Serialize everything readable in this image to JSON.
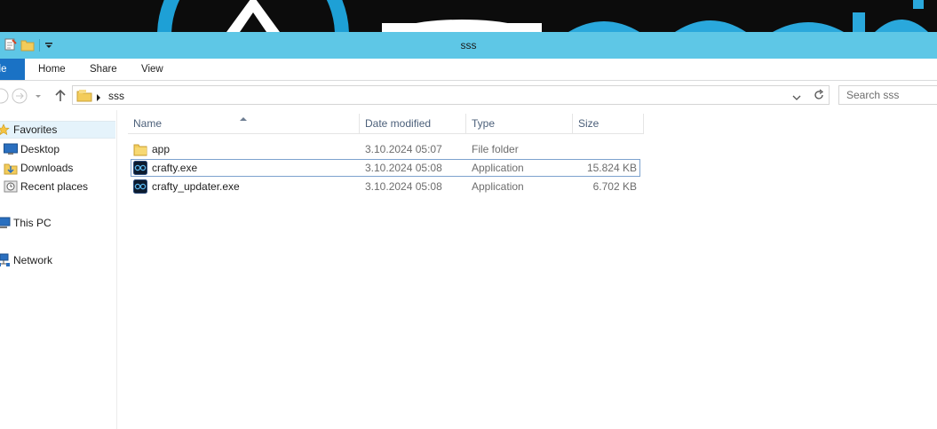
{
  "window": {
    "title": "sss"
  },
  "ribbon": {
    "tabs": [
      "ile",
      "Home",
      "Share",
      "View"
    ]
  },
  "address": {
    "crumb": "sss"
  },
  "search": {
    "placeholder": "Search sss"
  },
  "navpane": {
    "items": [
      {
        "label": "Favorites",
        "icon": "star-icon"
      },
      {
        "label": "Desktop",
        "icon": "desktop-icon"
      },
      {
        "label": "Downloads",
        "icon": "downloads-folder-icon"
      },
      {
        "label": "Recent places",
        "icon": "recent-places-icon"
      },
      {
        "label": "This PC",
        "icon": "computer-icon"
      },
      {
        "label": "Network",
        "icon": "network-icon"
      }
    ]
  },
  "columns": [
    "Name",
    "Date modified",
    "Type",
    "Size"
  ],
  "files": [
    {
      "name": "app",
      "date": "3.10.2024 05:07",
      "type": "File folder",
      "size": "",
      "icon": "folder-icon"
    },
    {
      "name": "crafty.exe",
      "date": "3.10.2024 05:08",
      "type": "Application",
      "size": "15.824 KB",
      "icon": "app-icon",
      "selected": true
    },
    {
      "name": "crafty_updater.exe",
      "date": "3.10.2024 05:08",
      "type": "Application",
      "size": "6.702 KB",
      "icon": "app-icon"
    }
  ],
  "colors": {
    "titlebar": "#5ec7e6",
    "file_tab": "#1a72c5",
    "selection_border": "#7da2ce",
    "nav_selection": "#e5f3fb"
  }
}
